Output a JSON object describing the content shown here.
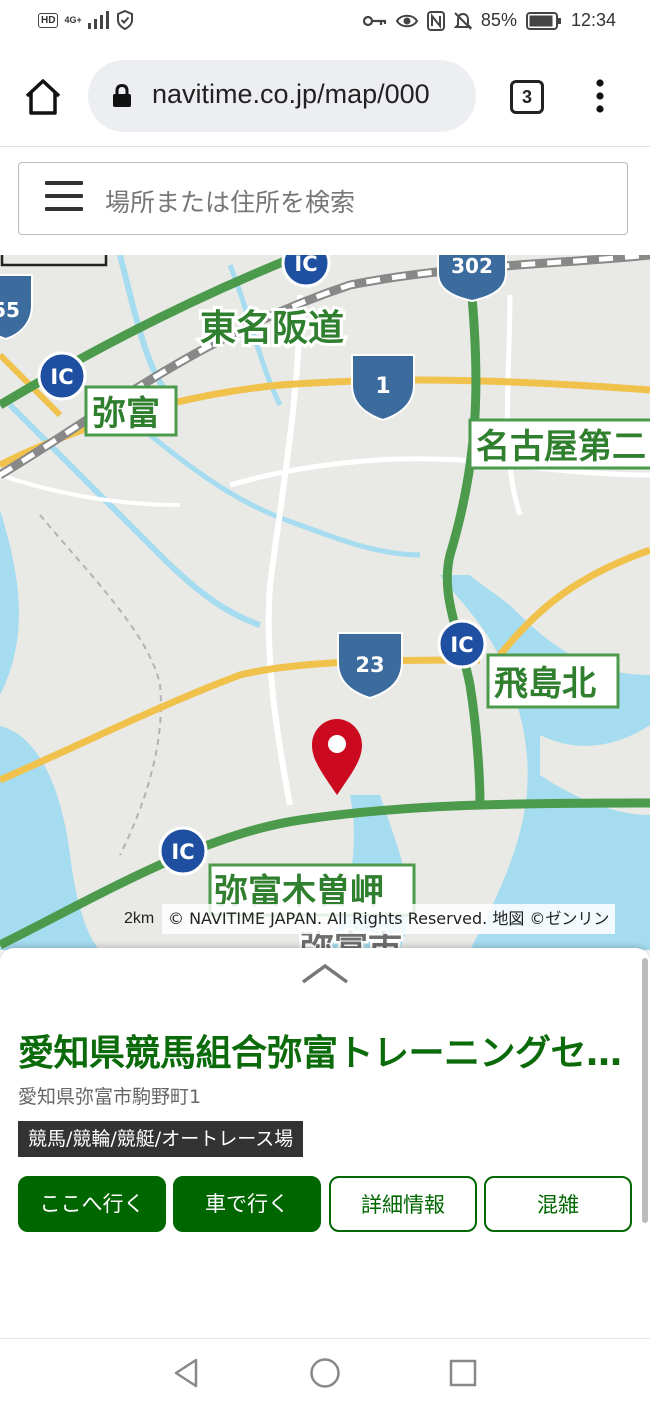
{
  "status_bar": {
    "hd": "HD",
    "network": "4G+",
    "battery_percent": "85%",
    "time": "12:34",
    "icons": [
      "signal-icon",
      "shield-icon",
      "key-icon",
      "eye-icon",
      "nfc-icon",
      "mute-icon",
      "battery-icon"
    ]
  },
  "browser": {
    "url": "navitime.co.jp/map/000",
    "tab_count": "3"
  },
  "search": {
    "placeholder": "場所または住所を検索"
  },
  "map": {
    "labels": {
      "tomei_hanshin": "東名阪道",
      "yatomi": "弥富",
      "nagoya_daini": "名古屋第二",
      "tobishima_kita": "飛島北",
      "yatomi_kisozaki": "弥富木曽岬",
      "yatomi_city": "弥富市",
      "ic": "IC",
      "route_1": "1",
      "route_23": "23",
      "route_302": "302",
      "route_155": "55"
    },
    "scale_label": "2km",
    "copyright": "© NAVITIME JAPAN. All Rights Reserved. 地図 ©ゼンリン",
    "colors": {
      "water": "#a5dcf0",
      "land": "#e9e9e6",
      "expressway": "#4c9a4c",
      "national_road": "#f0c24c",
      "pin": "#cc0a1f"
    }
  },
  "place": {
    "title": "愛知県競馬組合弥富トレーニングセ…",
    "address": "愛知県弥富市駒野町1",
    "category": "競馬/競輪/競艇/オートレース場"
  },
  "actions": {
    "go_here": "ここへ行く",
    "by_car": "車で行く",
    "details": "詳細情報",
    "congestion": "混雑"
  }
}
